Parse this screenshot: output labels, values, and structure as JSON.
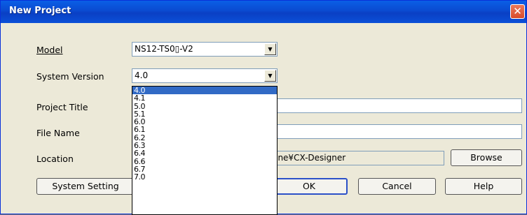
{
  "window": {
    "title": "New Project",
    "close_glyph": "✕"
  },
  "labels": {
    "model": "Model",
    "system_version": "System Version",
    "project_title": "Project Title",
    "file_name": "File Name",
    "location": "Location"
  },
  "model_combo": {
    "value": "NS12-TS0▯-V2"
  },
  "version_combo": {
    "value": "4.0"
  },
  "location_value": "One¥CX-Designer",
  "buttons": {
    "browse": "Browse",
    "system_setting": "System Setting",
    "ok": "OK",
    "cancel": "Cancel",
    "help": "Help"
  },
  "version_options": [
    "4.0",
    "4.1",
    "5.0",
    "5.1",
    "6.0",
    "6.1",
    "6.2",
    "6.3",
    "6.4",
    "6.6",
    "6.7",
    "7.0"
  ],
  "selected_option_index": 0,
  "icons": {
    "dropdown_arrow": "chevron-down-icon",
    "close": "close-icon"
  }
}
